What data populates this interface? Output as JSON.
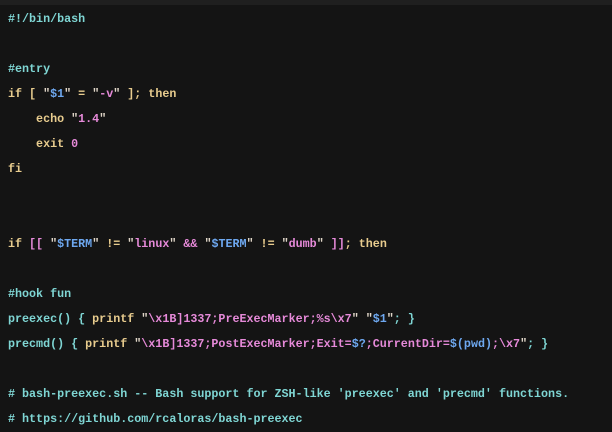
{
  "editor": {
    "language": "bash",
    "lines": [
      [
        [
          "c",
          "#!/bin/bash"
        ]
      ],
      [],
      [
        [
          "c",
          "#entry"
        ]
      ],
      [
        [
          "k",
          "if [ "
        ],
        [
          "q",
          "\""
        ],
        [
          "v",
          "$1"
        ],
        [
          "q",
          "\""
        ],
        [
          "k",
          " = "
        ],
        [
          "q",
          "\""
        ],
        [
          "s",
          "-v"
        ],
        [
          "q",
          "\""
        ],
        [
          "k",
          " ]; then"
        ]
      ],
      [
        [
          "k",
          "    echo "
        ],
        [
          "q",
          "\""
        ],
        [
          "s",
          "1.4"
        ],
        [
          "q",
          "\""
        ]
      ],
      [
        [
          "k",
          "    exit "
        ],
        [
          "s",
          "0"
        ]
      ],
      [
        [
          "k",
          "fi"
        ]
      ],
      [],
      [],
      [
        [
          "k",
          "if "
        ],
        [
          "p",
          "[["
        ],
        [
          "k",
          " "
        ],
        [
          "q",
          "\""
        ],
        [
          "v",
          "$TERM"
        ],
        [
          "q",
          "\""
        ],
        [
          "k",
          " != "
        ],
        [
          "q",
          "\""
        ],
        [
          "s",
          "linux"
        ],
        [
          "q",
          "\""
        ],
        [
          "k",
          " "
        ],
        [
          "p",
          "&&"
        ],
        [
          "k",
          " "
        ],
        [
          "q",
          "\""
        ],
        [
          "v",
          "$TERM"
        ],
        [
          "q",
          "\""
        ],
        [
          "k",
          " != "
        ],
        [
          "q",
          "\""
        ],
        [
          "s",
          "dumb"
        ],
        [
          "q",
          "\""
        ],
        [
          "k",
          " "
        ],
        [
          "p",
          "]]"
        ],
        [
          "k",
          "; then"
        ]
      ],
      [],
      [
        [
          "c",
          "#hook fun"
        ]
      ],
      [
        [
          "t",
          "preexec() { "
        ],
        [
          "k",
          "printf "
        ],
        [
          "q",
          "\""
        ],
        [
          "s",
          "\\x1B]1337;PreExecMarker;%s\\x7"
        ],
        [
          "q",
          "\""
        ],
        [
          "k",
          " "
        ],
        [
          "q",
          "\""
        ],
        [
          "v",
          "$1"
        ],
        [
          "q",
          "\""
        ],
        [
          "t",
          "; }"
        ]
      ],
      [
        [
          "t",
          "precmd() { "
        ],
        [
          "k",
          "printf "
        ],
        [
          "q",
          "\""
        ],
        [
          "s",
          "\\x1B]1337;PostExecMarker;Exit="
        ],
        [
          "v",
          "$?"
        ],
        [
          "s",
          ";CurrentDir="
        ],
        [
          "v",
          "$(pwd)"
        ],
        [
          "s",
          ";\\x7"
        ],
        [
          "q",
          "\""
        ],
        [
          "t",
          "; }"
        ]
      ],
      [],
      [
        [
          "c",
          "# bash-preexec.sh -- Bash support for ZSH-like 'preexec' and 'precmd' functions."
        ]
      ],
      [
        [
          "c",
          "# https://github.com/rcaloras/bash-preexec"
        ]
      ]
    ]
  }
}
